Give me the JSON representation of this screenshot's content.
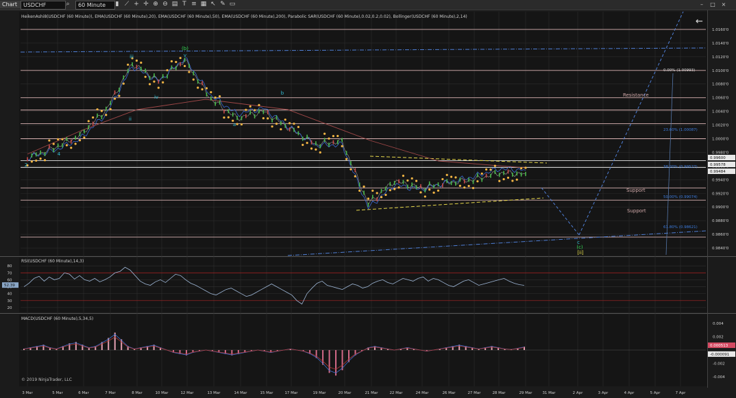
{
  "toolbar": {
    "chart_tab": "Chart",
    "symbol": "USDCHF",
    "interval": "60 Minute",
    "icons": [
      "search-icon",
      "bar-type-icon",
      "draw-icon",
      "plus-icon",
      "crosshair-icon",
      "zoom-in-icon",
      "zoom-out-icon",
      "properties-icon",
      "text-icon",
      "list-icon",
      "grid-icon",
      "cursor-icon",
      "pencil-icon",
      "layout-icon"
    ]
  },
  "panels": {
    "price_header": "HeikenAshi8(USDCHF (60 Minute)), EMA(USDCHF (60 Minute),20), EMA(USDCHF (60 Minute),50), EMA(USDCHF (60 Minute),200), Parabolic SAR(USDCHF (60 Minute),0.02,0.2,0.02), Bollinger(USDCHF (60 Minute),2,14)",
    "rsi_header": "RSI(USDCHF (60 Minute),14,3)",
    "macd_header": "MACD(USDCHF (60 Minute),5,34,5)",
    "copyright": "© 2019 NinjaTrader, LLC"
  },
  "colors": {
    "background": "#1b1b1b",
    "grid": "#2c2c2c",
    "sar": "#f2b544",
    "level_line": "#d9b3b3",
    "trend_blue": "#4f7fd6",
    "fib_blue": "#3d7de0",
    "wave_green": "#33dd55",
    "wave_cyan": "#33c0d8"
  },
  "chart_data": [
    {
      "type": "line",
      "panel": "price",
      "x": [
        "3 Mar",
        "5 Mar",
        "6 Mar",
        "7 Mar",
        "8 Mar",
        "10 Mar",
        "12 Mar",
        "13 Mar",
        "14 Mar",
        "15 Mar",
        "17 Mar",
        "19 Mar",
        "20 Mar",
        "21 Mar",
        "22 Mar",
        "24 Mar",
        "26 Mar",
        "27 Mar",
        "28 Mar",
        "29 Mar",
        "31 Mar",
        "2 Apr",
        "3 Apr",
        "4 Apr",
        "5 Apr",
        "7 Apr"
      ],
      "series": [
        {
          "values": [
            0.9972,
            0.9986,
            1.0005,
            1.0042,
            1.011,
            1.0085,
            1.0115,
            1.0058,
            1.003,
            1.004,
            1.0015,
            0.9992,
            0.9996,
            0.9905,
            0.9938,
            0.9928,
            0.9935,
            0.994,
            0.995,
            0.99484
          ]
        }
      ],
      "y_ticks": [
        "1.0160'0",
        "1.0140'0",
        "1.0120'0",
        "1.0100'0",
        "1.0080'0",
        "1.0060'0",
        "1.0040'0",
        "1.0020'0",
        "1.0000'0",
        "0.9980'0",
        "0.9960'0",
        "0.9940'0",
        "0.9920'0",
        "0.9900'0",
        "0.9880'0",
        "0.9860'0",
        "0.9840'0"
      ],
      "ylim": [
        0.983,
        1.0175
      ],
      "price_labels": [
        "0.99600",
        "0.99578",
        "0.99484"
      ],
      "horizontal_levels": [
        1.016,
        1.01,
        1.006,
        1.0042,
        1.0022,
        1.0,
        0.9968,
        0.9958,
        0.9928,
        0.991,
        0.9856
      ],
      "annotations": {
        "resistance": "Resistance",
        "support_1": "Support",
        "support_2": "Support",
        "fib": [
          "0.00% (1.00993)",
          "23.60% (1.00087)",
          "38.20% (0.99527)",
          "50.00% (0.99074)",
          "61.80% (0.98621)"
        ],
        "waves": [
          "(b)",
          "iii",
          "v",
          "iv",
          "ii",
          "a",
          "b",
          "2",
          "4",
          "c",
          "(c)",
          "[ii]"
        ]
      },
      "projection": [
        [
          0.9935,
          0.9854
        ],
        [
          0.9854,
          1.0185
        ]
      ]
    },
    {
      "type": "line",
      "panel": "rsi",
      "y_ticks": [
        "80",
        "70",
        "60",
        "50",
        "40",
        "30",
        "20"
      ],
      "ylim": [
        15,
        90
      ],
      "current_label": "52.39",
      "values": [
        50,
        55,
        62,
        65,
        58,
        64,
        60,
        62,
        70,
        68,
        61,
        66,
        60,
        58,
        62,
        57,
        60,
        64,
        70,
        72,
        78,
        74,
        66,
        58,
        54,
        52,
        57,
        60,
        56,
        62,
        68,
        66,
        60,
        55,
        52,
        48,
        44,
        40,
        38,
        42,
        46,
        48,
        44,
        40,
        36,
        38,
        42,
        46,
        50,
        54,
        50,
        46,
        42,
        38,
        30,
        25,
        40,
        48,
        55,
        58,
        52,
        50,
        48,
        46,
        50,
        54,
        52,
        48,
        50,
        55,
        58,
        60,
        56,
        54,
        58,
        62,
        60,
        58,
        62,
        64,
        58,
        62,
        60,
        56,
        52,
        50,
        54,
        58,
        60,
        56,
        52,
        54,
        56,
        58,
        60,
        62,
        58,
        55,
        53,
        52
      ]
    },
    {
      "type": "line",
      "panel": "macd",
      "y_ticks": [
        "0.004",
        "0.002",
        "-0.002",
        "-0.004"
      ],
      "ylim": [
        -0.0052,
        0.0052
      ],
      "current_labels": [
        "0.000513",
        "-0.000091"
      ],
      "values": [
        0.0002,
        0.0004,
        0.0006,
        0.0008,
        0.0004,
        0.0002,
        0.0006,
        0.001,
        0.0012,
        0.0008,
        0.0004,
        0.0006,
        0.0012,
        0.0018,
        0.0026,
        0.0016,
        0.0006,
        0.0002,
        0.0004,
        0.0006,
        0.0008,
        0.0004,
        0.0,
        -0.0004,
        -0.0006,
        -0.0008,
        -0.0004,
        -0.0002,
        0.0,
        -0.0002,
        -0.0004,
        -0.0006,
        -0.0008,
        -0.0006,
        -0.0004,
        -0.0002,
        0.0,
        -0.0002,
        -0.0004,
        -0.0002,
        0.0,
        0.0002,
        0.0,
        -0.0002,
        -0.0006,
        -0.0012,
        -0.0022,
        -0.0034,
        -0.0038,
        -0.003,
        -0.0018,
        -0.0008,
        -0.0002,
        0.0004,
        0.0006,
        0.0004,
        0.0002,
        0.0,
        0.0002,
        0.0004,
        0.0002,
        0.0,
        -0.0002,
        0.0,
        0.0002,
        0.0004,
        0.0006,
        0.0008,
        0.0006,
        0.0004,
        0.0002,
        0.0004,
        0.0006,
        0.0004,
        0.0002,
        0.0001,
        0.0003,
        0.0005
      ]
    }
  ]
}
